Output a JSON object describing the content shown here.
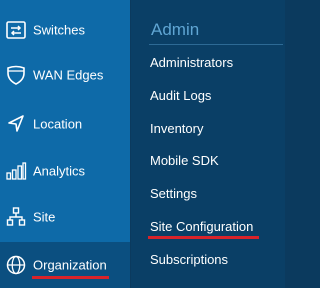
{
  "sidebar": {
    "items": [
      {
        "label": "Switches",
        "icon": "switches-icon"
      },
      {
        "label": "WAN Edges",
        "icon": "shield-icon"
      },
      {
        "label": "Location",
        "icon": "location-arrow-icon"
      },
      {
        "label": "Analytics",
        "icon": "analytics-bars-icon"
      },
      {
        "label": "Site",
        "icon": "site-hierarchy-icon"
      },
      {
        "label": "Organization",
        "icon": "globe-icon",
        "active": true
      }
    ]
  },
  "submenu": {
    "header": "Admin",
    "items": [
      {
        "label": "Administrators"
      },
      {
        "label": "Audit Logs"
      },
      {
        "label": "Inventory"
      },
      {
        "label": "Mobile SDK"
      },
      {
        "label": "Settings"
      },
      {
        "label": "Site Configuration",
        "highlighted": true
      },
      {
        "label": "Subscriptions"
      }
    ]
  },
  "colors": {
    "sidebar_bg": "#0e6aa8",
    "sidebar_active_bg": "#0b4f80",
    "submenu_bg": "#0a3f66",
    "header_text": "#5fa5d3",
    "highlight_underline": "#d8232a"
  }
}
